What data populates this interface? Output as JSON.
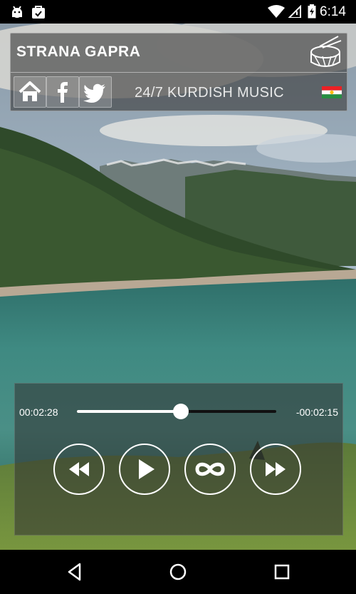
{
  "status_bar": {
    "time": "6:14"
  },
  "header": {
    "title": "STRANA GAPRA",
    "tagline": "24/7 KURDISH MUSIC",
    "social_buttons": [
      "home",
      "facebook",
      "twitter"
    ]
  },
  "player": {
    "elapsed": "00:02:28",
    "remaining": "-00:02:15",
    "progress": 0.52,
    "controls": [
      "rewind",
      "play",
      "loop",
      "fast-forward"
    ]
  },
  "colors": {
    "flag_red": "#ED2024",
    "flag_white": "#FFFFFF",
    "flag_green": "#278E43",
    "flag_sun": "#FEBD11"
  }
}
